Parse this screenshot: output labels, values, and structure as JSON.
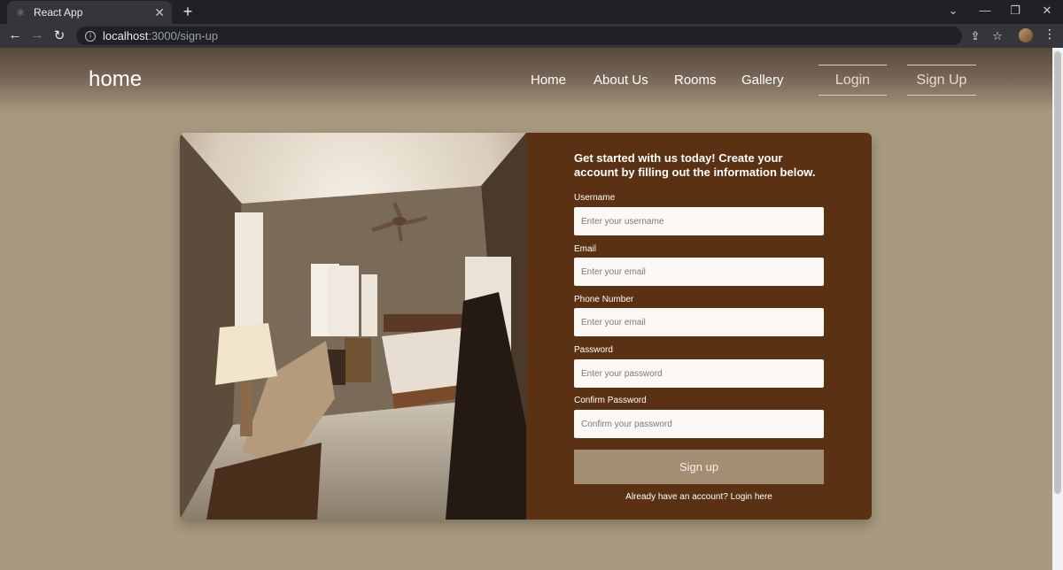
{
  "browser": {
    "tab_title": "React App",
    "url_host": "localhost",
    "url_path": ":3000/sign-up"
  },
  "navbar": {
    "brand": "home",
    "links": [
      "Home",
      "About Us",
      "Rooms",
      "Gallery"
    ],
    "login_label": "Login",
    "signup_label": "Sign Up"
  },
  "form": {
    "intro": "Get started with us today! Create your account by filling out the information below.",
    "fields": [
      {
        "label": "Username",
        "placeholder": "Enter your username"
      },
      {
        "label": "Email",
        "placeholder": "Enter your email"
      },
      {
        "label": "Phone Number",
        "placeholder": "Enter your email"
      },
      {
        "label": "Password",
        "placeholder": "Enter your password"
      },
      {
        "label": "Confirm Password",
        "placeholder": "Confirm your password"
      }
    ],
    "submit_label": "Sign up",
    "login_prompt": "Already have an account? Login here"
  },
  "colors": {
    "page_bg": "#a89a80",
    "form_bg": "#5a3112",
    "button_bg": "#a48e73"
  }
}
